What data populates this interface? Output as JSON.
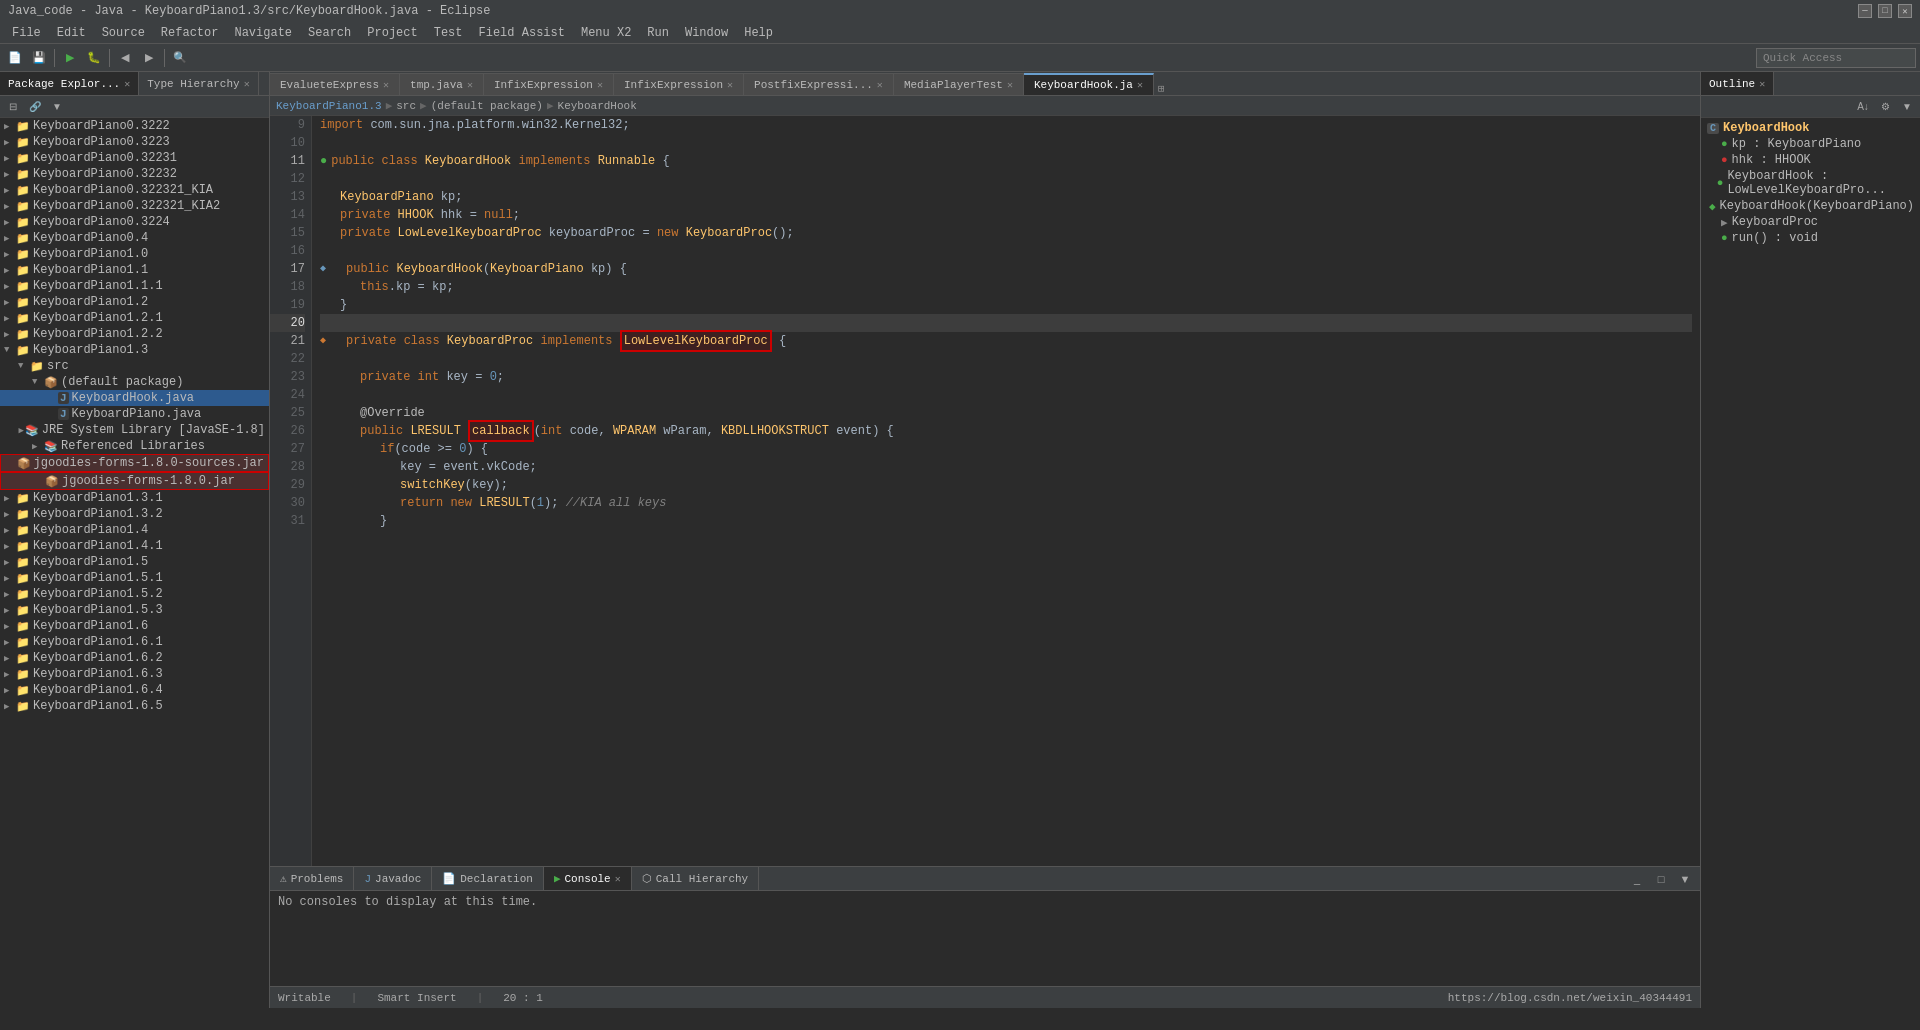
{
  "titlebar": {
    "title": "Java_code - Java - KeyboardPiano1.3/src/KeyboardHook.java - Eclipse",
    "minimize": "─",
    "maximize": "□",
    "close": "✕"
  },
  "menubar": {
    "items": [
      "File",
      "Edit",
      "Source",
      "Refactor",
      "Navigate",
      "Search",
      "Project",
      "Test",
      "Field Assist",
      "Menu X2",
      "Run",
      "Window",
      "Help"
    ]
  },
  "left_panel": {
    "tabs": [
      {
        "label": "Package Explor...",
        "active": true
      },
      {
        "label": "Type Hierarchy",
        "active": false
      }
    ],
    "tree_items": [
      {
        "indent": 0,
        "label": "KeyboardPiano0.3222",
        "icon": "📁",
        "arrow": "▶"
      },
      {
        "indent": 0,
        "label": "KeyboardPiano0.3223",
        "icon": "📁",
        "arrow": "▶"
      },
      {
        "indent": 0,
        "label": "KeyboardPiano0.32231",
        "icon": "📁",
        "arrow": "▶"
      },
      {
        "indent": 0,
        "label": "KeyboardPiano0.32232",
        "icon": "📁",
        "arrow": "▶"
      },
      {
        "indent": 0,
        "label": "KeyboardPiano0.322321_KIA",
        "icon": "📁",
        "arrow": "▶"
      },
      {
        "indent": 0,
        "label": "KeyboardPiano0.322321_KIA2",
        "icon": "📁",
        "arrow": "▶"
      },
      {
        "indent": 0,
        "label": "KeyboardPiano0.3224",
        "icon": "📁",
        "arrow": "▶"
      },
      {
        "indent": 0,
        "label": "KeyboardPiano0.4",
        "icon": "📁",
        "arrow": "▶"
      },
      {
        "indent": 0,
        "label": "KeyboardPiano1.0",
        "icon": "📁",
        "arrow": "▶"
      },
      {
        "indent": 0,
        "label": "KeyboardPiano1.1",
        "icon": "📁",
        "arrow": "▶"
      },
      {
        "indent": 0,
        "label": "KeyboardPiano1.1.1",
        "icon": "📁",
        "arrow": "▶"
      },
      {
        "indent": 0,
        "label": "KeyboardPiano1.2",
        "icon": "📁",
        "arrow": "▶"
      },
      {
        "indent": 0,
        "label": "KeyboardPiano1.2.1",
        "icon": "📁",
        "arrow": "▶"
      },
      {
        "indent": 0,
        "label": "KeyboardPiano1.2.2",
        "icon": "📁",
        "arrow": "▶"
      },
      {
        "indent": 0,
        "label": "KeyboardPiano1.3",
        "icon": "📁",
        "arrow": "▼",
        "expanded": true
      },
      {
        "indent": 1,
        "label": "src",
        "icon": "📁",
        "arrow": "▼",
        "expanded": true
      },
      {
        "indent": 2,
        "label": "(default package)",
        "icon": "📦",
        "arrow": "▼",
        "expanded": true
      },
      {
        "indent": 3,
        "label": "KeyboardHook.java",
        "icon": "J",
        "arrow": "",
        "selected": true
      },
      {
        "indent": 3,
        "label": "KeyboardPiano.java",
        "icon": "J",
        "arrow": ""
      },
      {
        "indent": 2,
        "label": "JRE System Library [JavaSE-1.8]",
        "icon": "📚",
        "arrow": "▶"
      },
      {
        "indent": 2,
        "label": "Referenced Libraries",
        "icon": "📚",
        "arrow": "▶"
      },
      {
        "indent": 2,
        "label": "jgoodies-forms-1.8.0-sources.jar",
        "icon": "📦",
        "arrow": "",
        "highlighted": true
      },
      {
        "indent": 2,
        "label": "jgoodies-forms-1.8.0.jar",
        "icon": "📦",
        "arrow": "",
        "highlighted2": true
      },
      {
        "indent": 0,
        "label": "KeyboardPiano1.3.1",
        "icon": "📁",
        "arrow": "▶"
      },
      {
        "indent": 0,
        "label": "KeyboardPiano1.3.2",
        "icon": "📁",
        "arrow": "▶"
      },
      {
        "indent": 0,
        "label": "KeyboardPiano1.4",
        "icon": "📁",
        "arrow": "▶"
      },
      {
        "indent": 0,
        "label": "KeyboardPiano1.4.1",
        "icon": "📁",
        "arrow": "▶"
      },
      {
        "indent": 0,
        "label": "KeyboardPiano1.5",
        "icon": "📁",
        "arrow": "▶"
      },
      {
        "indent": 0,
        "label": "KeyboardPiano1.5.1",
        "icon": "📁",
        "arrow": "▶"
      },
      {
        "indent": 0,
        "label": "KeyboardPiano1.5.2",
        "icon": "📁",
        "arrow": "▶"
      },
      {
        "indent": 0,
        "label": "KeyboardPiano1.5.3",
        "icon": "📁",
        "arrow": "▶"
      },
      {
        "indent": 0,
        "label": "KeyboardPiano1.6",
        "icon": "📁",
        "arrow": "▶"
      },
      {
        "indent": 0,
        "label": "KeyboardPiano1.6.1",
        "icon": "📁",
        "arrow": "▶"
      },
      {
        "indent": 0,
        "label": "KeyboardPiano1.6.2",
        "icon": "📁",
        "arrow": "▶"
      },
      {
        "indent": 0,
        "label": "KeyboardPiano1.6.3",
        "icon": "📁",
        "arrow": "▶"
      },
      {
        "indent": 0,
        "label": "KeyboardPiano1.6.4",
        "icon": "📁",
        "arrow": "▶"
      },
      {
        "indent": 0,
        "label": "KeyboardPiano1.6.5",
        "icon": "📁",
        "arrow": "▶"
      }
    ]
  },
  "editor_tabs": [
    {
      "label": "EvalueteExpress",
      "active": false,
      "close": "✕"
    },
    {
      "label": "tmp.java",
      "active": false,
      "close": "✕"
    },
    {
      "label": "InfixExpression",
      "active": false,
      "close": "✕"
    },
    {
      "label": "InfixExpression",
      "active": false,
      "close": "✕"
    },
    {
      "label": "PostfixExpressi...",
      "active": false,
      "close": "✕"
    },
    {
      "label": "MediaPlayerTest",
      "active": false,
      "close": "✕"
    },
    {
      "label": "KeyboardHook.ja",
      "active": true,
      "close": "✕"
    }
  ],
  "breadcrumb": {
    "parts": [
      "KeyboardPiano1.3",
      "src",
      "(default package)",
      "KeyboardHook"
    ]
  },
  "quick_access": {
    "placeholder": "Quick Access"
  },
  "code_lines": [
    {
      "num": "9",
      "marker": false,
      "content": "import_com.sun.jna.platform.win32.Kernel32;"
    },
    {
      "num": "10",
      "marker": false,
      "content": ""
    },
    {
      "num": "11",
      "marker": false,
      "content": "public_class_KeyboardHook_implements_Runnable_{"
    },
    {
      "num": "12",
      "marker": false,
      "content": ""
    },
    {
      "num": "13",
      "marker": false,
      "content": "    KeyboardPiano_kp;"
    },
    {
      "num": "14",
      "marker": false,
      "content": "    private_HHOOK_hhk_=_null;"
    },
    {
      "num": "15",
      "marker": false,
      "content": "    private_LowLevelKeyboardProc_keyboardProc_=_new_KeyboardProc();"
    },
    {
      "num": "16",
      "marker": false,
      "content": ""
    },
    {
      "num": "17",
      "marker": true,
      "content": "    public_KeyboardHook(KeyboardPiano_kp)_{"
    },
    {
      "num": "18",
      "marker": false,
      "content": "        this.kp_=_kp;"
    },
    {
      "num": "19",
      "marker": false,
      "content": "    }"
    },
    {
      "num": "20",
      "marker": false,
      "content": ""
    },
    {
      "num": "21",
      "marker": true,
      "content": "    private_class_KeyboardProc_implements_[LowLevelKeyboardProc]_{"
    },
    {
      "num": "22",
      "marker": false,
      "content": ""
    },
    {
      "num": "23",
      "marker": false,
      "content": "        private_int_key_=_0;"
    },
    {
      "num": "24",
      "marker": false,
      "content": ""
    },
    {
      "num": "25",
      "marker": false,
      "content": "        @Override"
    },
    {
      "num": "26",
      "marker": false,
      "content": "        public_LRESULT_[callback](int_code,_WPARAM_wParam,_KBDLLHOOKSTRUCT_event)_{"
    },
    {
      "num": "27",
      "marker": false,
      "content": "            if(code_>=_0)_{"
    },
    {
      "num": "28",
      "marker": false,
      "content": "                key_=_event.vkCode;"
    },
    {
      "num": "29",
      "marker": false,
      "content": "                switchKey(key);"
    },
    {
      "num": "30",
      "marker": false,
      "content": "                return_new_LRESULT(1);_//KIA_all_keys"
    },
    {
      "num": "31",
      "marker": false,
      "content": "            }"
    }
  ],
  "outline": {
    "title": "Outline",
    "items": [
      {
        "indent": 0,
        "label": "KeyboardHook",
        "icon": "C",
        "color": "#6897bb"
      },
      {
        "indent": 1,
        "label": "kp : KeyboardPiano",
        "icon": "●",
        "color": "#4aad4a"
      },
      {
        "indent": 1,
        "label": "hhk : HHOOK",
        "icon": "●",
        "color": "#cc3333"
      },
      {
        "indent": 1,
        "label": "KeyboardHook : LowLevelKeyboardPro...",
        "icon": "●",
        "color": "#4aad4a"
      },
      {
        "indent": 1,
        "label": "KeyboardHook(KeyboardPiano)",
        "icon": "◆",
        "color": "#4aad4a"
      },
      {
        "indent": 1,
        "label": "KeyboardProc",
        "icon": "▶",
        "color": "#888"
      },
      {
        "indent": 1,
        "label": "run() : void",
        "icon": "●",
        "color": "#4aad4a"
      }
    ]
  },
  "bottom_panel": {
    "tabs": [
      {
        "label": "Problems",
        "icon": "⚠",
        "active": false
      },
      {
        "label": "Javadoc",
        "icon": "J",
        "active": false
      },
      {
        "label": "Declaration",
        "icon": "📄",
        "active": false
      },
      {
        "label": "Console",
        "icon": "▶",
        "active": true,
        "close": "✕"
      },
      {
        "label": "Call Hierarchy",
        "icon": "⬡",
        "active": false
      }
    ],
    "console_text": "No consoles to display at this time."
  },
  "status_bar": {
    "writable": "Writable",
    "insert_mode": "Smart Insert",
    "position": "20 : 1",
    "url": "https://blog.csdn.net/weixin_40344491"
  }
}
